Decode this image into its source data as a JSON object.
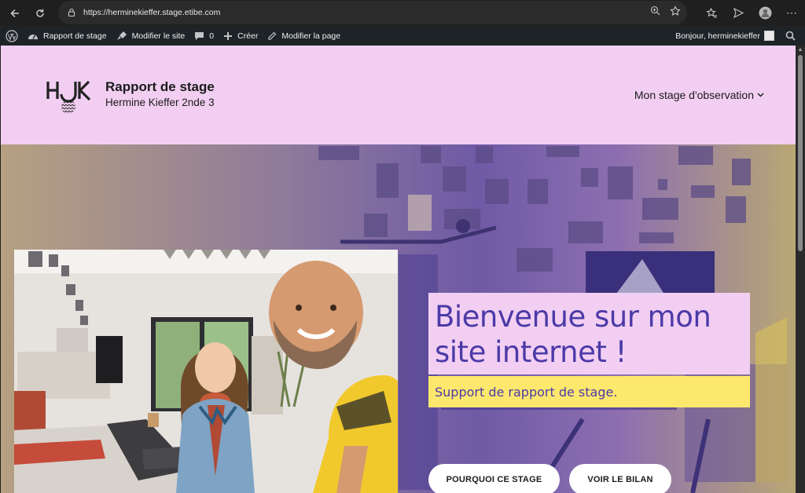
{
  "browser": {
    "url": "https://herminekieffer.stage.etibe.com"
  },
  "adminbar": {
    "wp_logo": "wordpress-icon",
    "items": [
      {
        "label": "Rapport de stage"
      },
      {
        "label": "Modifier le site"
      },
      {
        "label": "0"
      },
      {
        "label": "Créer"
      },
      {
        "label": "Modifier la page"
      }
    ],
    "greeting": "Bonjour, herminekieffer"
  },
  "header": {
    "logo_text": "HJK",
    "site_title": "Rapport de stage",
    "tagline": "Hermine Kieffer 2nde 3",
    "nav_label": "Mon stage d'observation"
  },
  "hero": {
    "title": "Bienvenue sur mon site internet !",
    "subtitle": "Support de rapport de stage.",
    "button1": "POURQUOI CE STAGE",
    "button2": "VOIR LE BILAN"
  },
  "colors": {
    "header_bg": "#f2cff2",
    "accent_purple": "#4c3aa7",
    "accent_yellow": "#fde86e"
  }
}
